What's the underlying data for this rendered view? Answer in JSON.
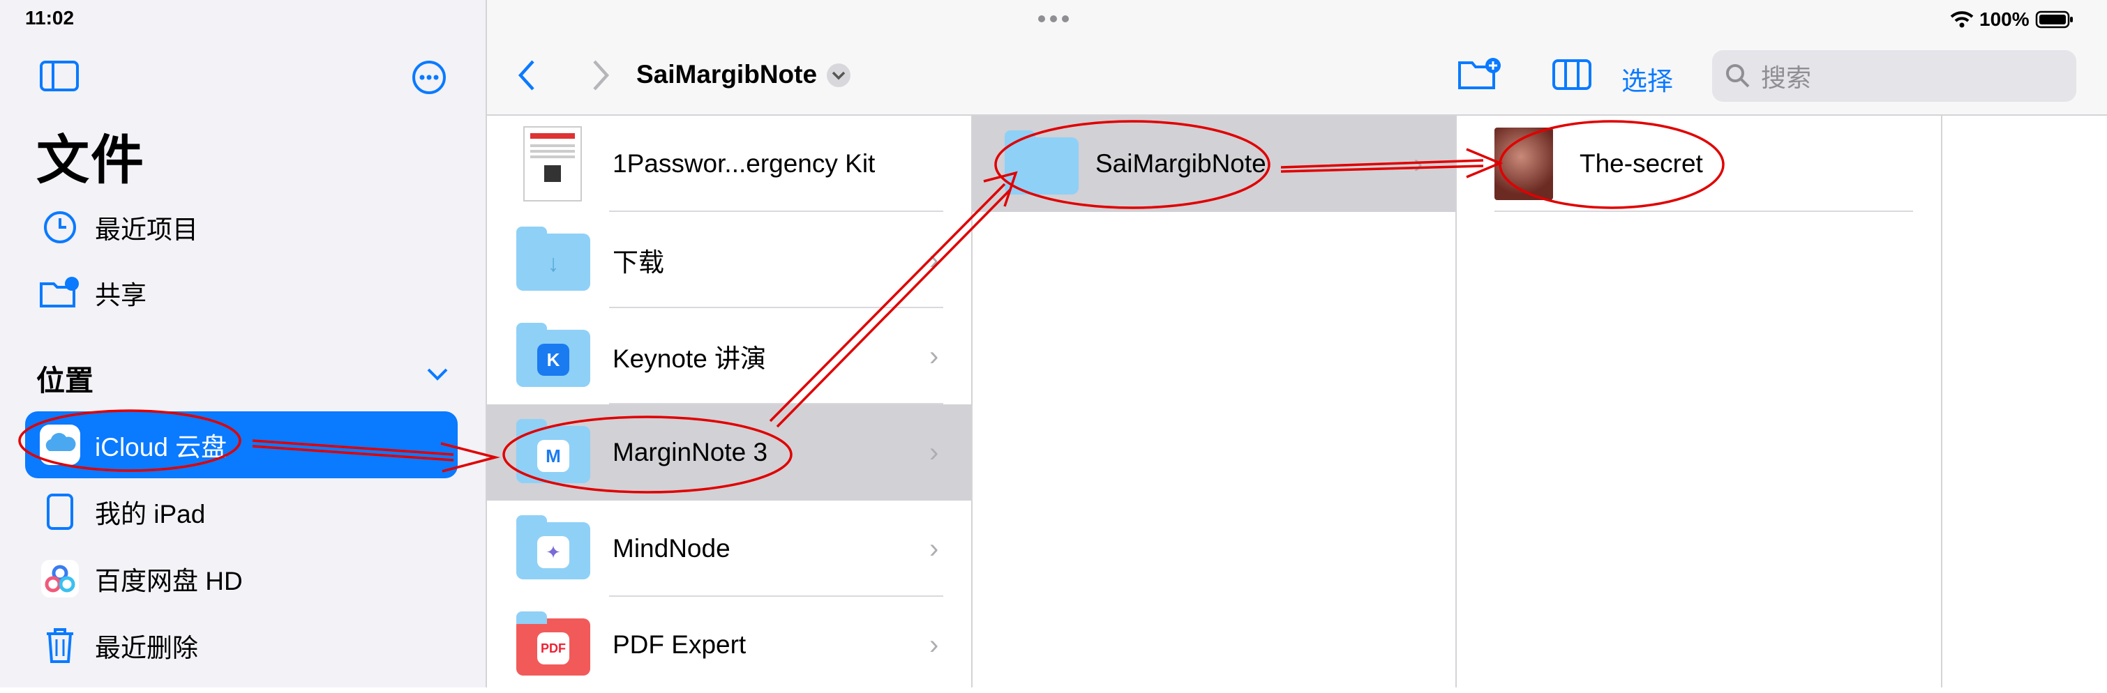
{
  "status": {
    "time": "11:02",
    "battery": "100%"
  },
  "sidebar": {
    "title": "文件",
    "items_top": [
      {
        "label": "最近项目",
        "icon": "clock-icon"
      },
      {
        "label": "共享",
        "icon": "shared-folder-icon"
      }
    ],
    "section": "位置",
    "locations": [
      {
        "label": "iCloud 云盘",
        "icon": "icloud-icon",
        "selected": true
      },
      {
        "label": "我的 iPad",
        "icon": "ipad-icon"
      },
      {
        "label": "百度网盘 HD",
        "icon": "baidu-netdisk-icon"
      },
      {
        "label": "最近删除",
        "icon": "trash-icon"
      }
    ]
  },
  "toolbar": {
    "title": "SaiMargibNote",
    "select_label": "选择",
    "search_placeholder": "搜索"
  },
  "columns": {
    "col1": [
      {
        "name": "1Passwor...ergency Kit",
        "type": "document"
      },
      {
        "name": "下载",
        "type": "folder",
        "badge": "↓"
      },
      {
        "name": "Keynote 讲演",
        "type": "folder",
        "badge": "K"
      },
      {
        "name": "MarginNote 3",
        "type": "folder",
        "badge": "M",
        "selected": true
      },
      {
        "name": "MindNode",
        "type": "folder",
        "badge": "✦"
      },
      {
        "name": "PDF Expert",
        "type": "folder",
        "badge": "PDF"
      }
    ],
    "col2": [
      {
        "name": "SaiMargibNote",
        "type": "folder",
        "selected": true
      }
    ],
    "col3": [
      {
        "name": "The-secret",
        "type": "image"
      }
    ]
  },
  "colors": {
    "accent": "#0a7aff",
    "annotation": "#e00000",
    "folder": "#8fd0f7"
  }
}
